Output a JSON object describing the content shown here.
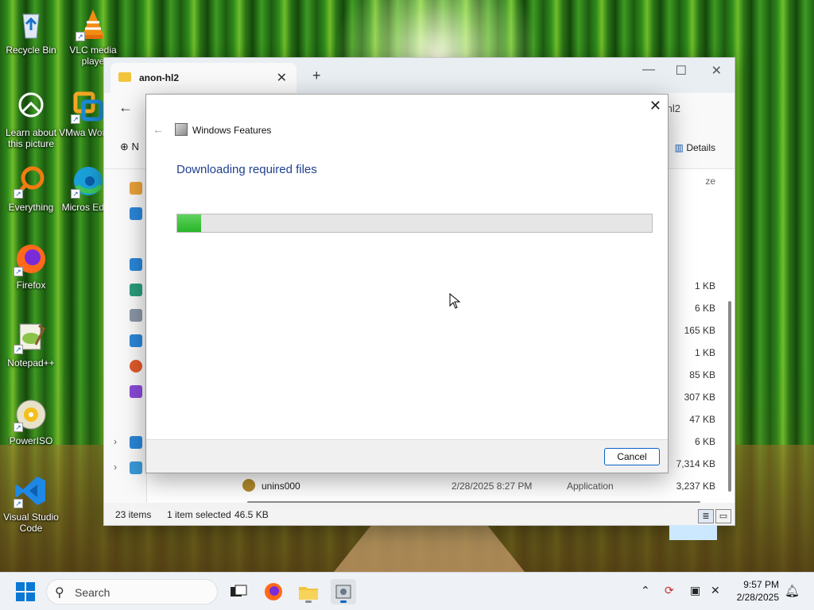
{
  "desktop": {
    "icons": [
      {
        "label": "Recycle Bin",
        "icon": "recycle-bin-icon"
      },
      {
        "label": "VLC media playe",
        "icon": "vlc-icon"
      },
      {
        "label": "Learn about this picture",
        "icon": "learn-picture-icon"
      },
      {
        "label": "VMwa Workst",
        "icon": "vmware-icon"
      },
      {
        "label": "Everything",
        "icon": "everything-icon"
      },
      {
        "label": "Micros Edge",
        "icon": "edge-icon"
      },
      {
        "label": "Firefox",
        "icon": "firefox-icon"
      },
      {
        "label": "Notepad++",
        "icon": "notepadpp-icon"
      },
      {
        "label": "PowerISO",
        "icon": "poweriso-icon"
      },
      {
        "label": "Visual Studio Code",
        "icon": "vscode-icon"
      }
    ]
  },
  "explorer": {
    "tab_title": "anon-hl2",
    "tab_close": "✕",
    "new_tab": "+",
    "minimize": "—",
    "maximize": "☐",
    "close": "✕",
    "back": "←",
    "breadcrumb_tail": "hl2",
    "new_button": "N",
    "details_button": "Details",
    "size_header": "ze",
    "sizes": [
      "1 KB",
      "6 KB",
      "165 KB",
      "1 KB",
      "85 KB",
      "307 KB",
      "47 KB",
      "6 KB",
      "7,314 KB",
      "3,237 KB"
    ],
    "last_row": {
      "name": "unins000",
      "date": "2/28/2025 8:27 PM",
      "type": "Application"
    },
    "status": {
      "items": "23 items",
      "selected": "1 item selected",
      "size": "46.5 KB"
    }
  },
  "dialog": {
    "title": "Windows Features",
    "heading": "Downloading required files",
    "progress": 0.05,
    "cancel_label": "Cancel",
    "close": "✕",
    "back": "←"
  },
  "taskbar": {
    "search_label": "Search",
    "time": "9:57 PM",
    "date": "2/28/2025"
  },
  "colors": {
    "accent": "#0a64c8",
    "progress": "#28b628",
    "heading": "#1f3f8f"
  }
}
